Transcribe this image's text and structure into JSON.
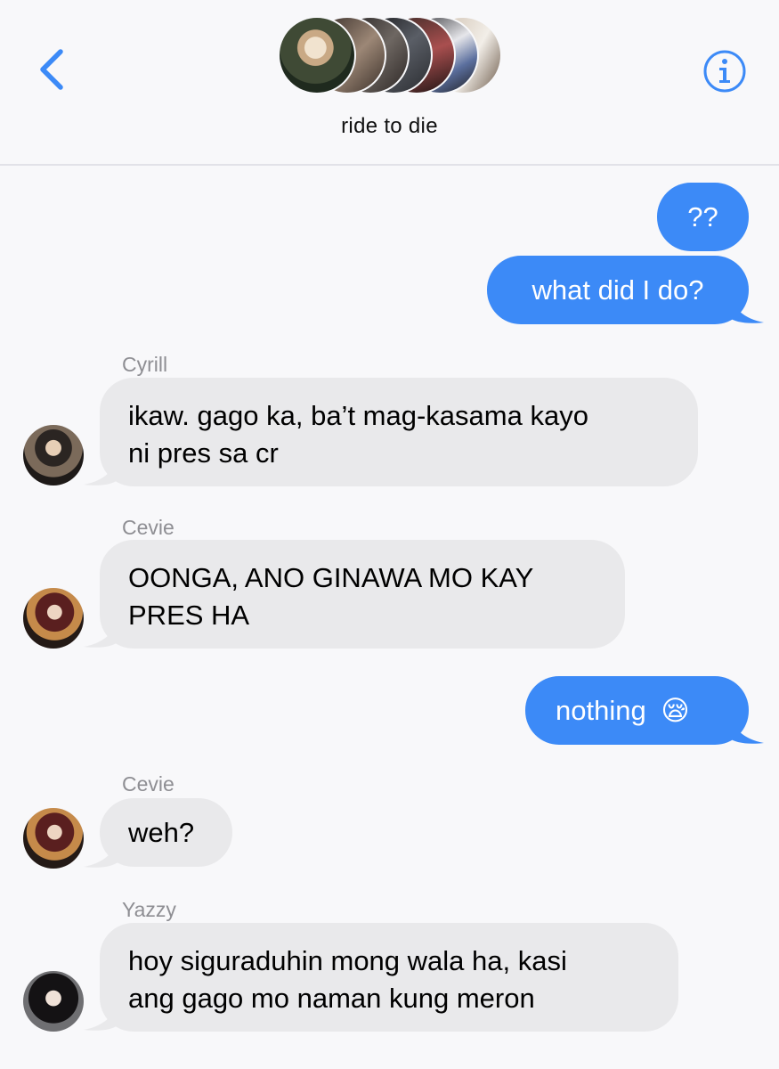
{
  "header": {
    "back_icon": "chevron-left-icon",
    "info_icon": "info-circle-icon",
    "group_name": "ride to die",
    "accent_color": "#3c8af7"
  },
  "messages": [
    {
      "direction": "sent",
      "text": "??"
    },
    {
      "direction": "sent",
      "text": "what did I do?"
    },
    {
      "direction": "received",
      "sender": "Cyrill",
      "lines": [
        "ikaw. gago ka, ba’t mag-kasama kayo",
        "ni pres sa cr"
      ]
    },
    {
      "direction": "received",
      "sender": "Cevie",
      "lines": [
        "OONGA, ANO GINAWA MO KAY",
        "PRES HA"
      ]
    },
    {
      "direction": "sent",
      "text": "nothing",
      "emoji": "😪"
    },
    {
      "direction": "received",
      "sender": "Cevie",
      "lines": [
        "weh?"
      ]
    },
    {
      "direction": "received",
      "sender": "Yazzy",
      "lines": [
        "hoy siguraduhin mong wala ha, kasi",
        "ang gago mo naman kung meron"
      ]
    }
  ]
}
